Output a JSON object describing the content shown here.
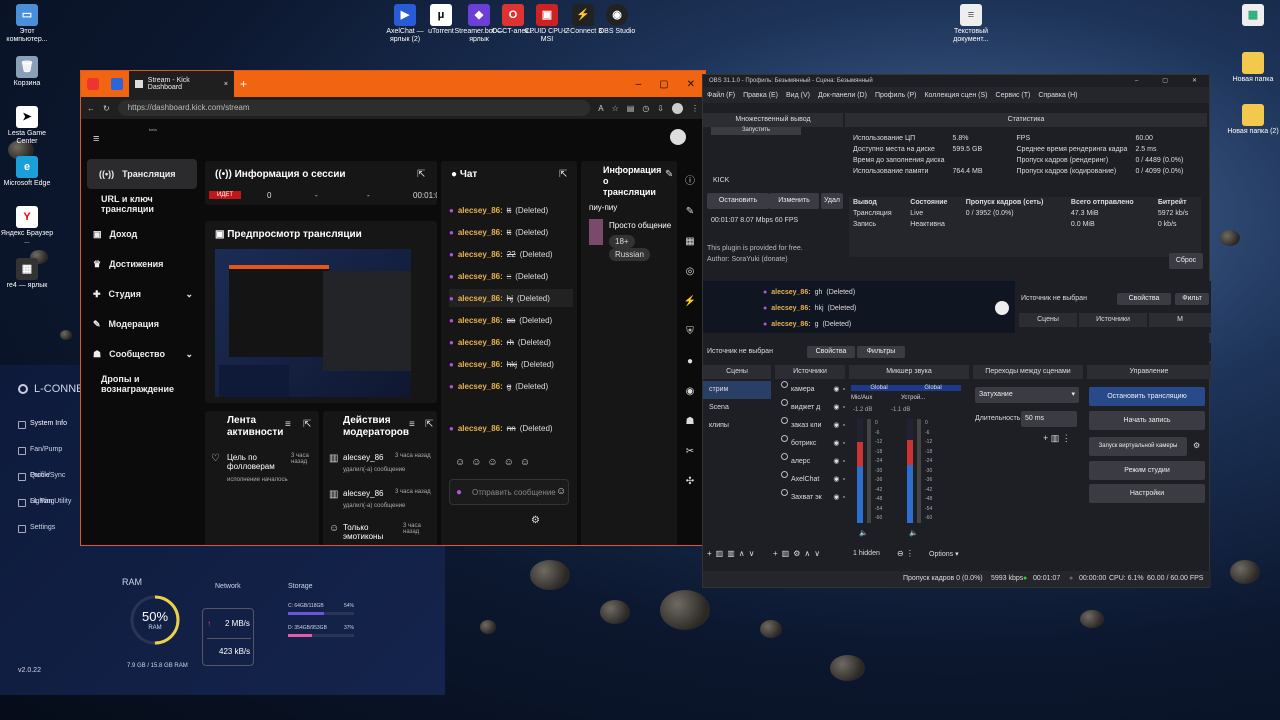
{
  "desktop": {
    "icons_left": [
      {
        "label": "Этот компьютер...",
        "icon": "computer-icon"
      },
      {
        "label": "Корзина",
        "icon": "trash-icon"
      },
      {
        "label": "Lesta Game Center",
        "icon": "lesta-icon"
      },
      {
        "label": "Microsoft Edge",
        "icon": "edge-icon"
      },
      {
        "label": "Яндекс Браузер ...",
        "icon": "yandex-icon"
      },
      {
        "label": "re4 — ярлык",
        "icon": "game-icon"
      }
    ],
    "icons_top": [
      {
        "label": "AxelChat — ярлык (2)",
        "icon": "axelchat-icon"
      },
      {
        "label": "uTorrent",
        "icon": "utorrent-icon"
      },
      {
        "label": "Streamer.bot — ярлык",
        "icon": "streamerbot-icon"
      },
      {
        "label": "OCCT-алек...",
        "icon": "occt-icon"
      },
      {
        "label": "CPUID CPU-Z MSI",
        "icon": "cpuz-icon"
      },
      {
        "label": "L-Connect 3",
        "icon": "lconnect-icon"
      },
      {
        "label": "OBS Studio",
        "icon": "obs-icon"
      }
    ],
    "icon_text_doc": "Текстовый документ...",
    "icons_right": [
      "Новая папка",
      "Новая папка (2)"
    ]
  },
  "lconnect": {
    "title": "L-CONNECT 3",
    "menu": [
      "System Info",
      "Fan/Pump Profile",
      "Quick/Sync Lighting",
      "SL Fan Utility",
      "Settings"
    ],
    "version": "v2.0.22",
    "ram_label": "RAM",
    "ram_percent": "50%",
    "ram_sub": "RAM",
    "ram_usage": "7.9 GB / 15.8 GB RAM",
    "ram_fraction": 0.5,
    "network_label": "Network",
    "net_up": "2 MB/s",
    "net_down": "423 kB/s",
    "storage_label": "Storage",
    "drives": [
      {
        "name": "C: 64GB/118GB",
        "pct": "54%",
        "fraction": 0.54
      },
      {
        "name": "D: 354GB/953GB",
        "pct": "37%",
        "fraction": 0.37
      }
    ]
  },
  "browser": {
    "tab_title": "Stream - Kick Dashboard",
    "new_tab": "+",
    "url": "https://dashboard.kick.com/stream",
    "kick_logo": "beta",
    "sidebar": [
      "Трансляция",
      "URL и ключ трансляции",
      "Доход",
      "Достижения",
      "Студия",
      "Модерация",
      "Сообщество",
      "Дропы и вознаграждение"
    ],
    "session": {
      "title": "Информация о сессии",
      "live": "ИДЕТ",
      "val1": "0",
      "val2": "-",
      "val3": "-",
      "time": "00:01:0"
    },
    "preview_title": "Предпросмотр трансляции",
    "feed": {
      "title": "Лента активности",
      "item_title": "Цель по фолловерам",
      "item_sub": "исполнение началось",
      "item_time": "3 часа назад"
    },
    "mod": {
      "title": "Действия модераторов",
      "rows": [
        {
          "user": "alecsey_86",
          "action": "удалил(-а) сообщение",
          "time": "3 часа назад"
        },
        {
          "user": "alecsey_86",
          "action": "удалил(-а) сообщение",
          "time": "3 часа назад"
        },
        {
          "user": "Только эмотиконы",
          "action": "",
          "time": "3 часа назад"
        }
      ]
    },
    "chat": {
      "title": "Чат",
      "rows": [
        {
          "user": "alecsey_86:",
          "msg": "tt",
          "del": "(Deleted)"
        },
        {
          "user": "alecsey_86:",
          "msg": "tt",
          "del": "(Deleted)"
        },
        {
          "user": "alecsey_86:",
          "msg": "22",
          "del": "(Deleted)"
        },
        {
          "user": "alecsey_86:",
          "msg": "::",
          "del": "(Deleted)"
        },
        {
          "user": "alecsey_86:",
          "msg": "hj",
          "del": "(Deleted)"
        },
        {
          "user": "alecsey_86:",
          "msg": "вв",
          "del": "(Deleted)"
        },
        {
          "user": "alecsey_86:",
          "msg": "rh",
          "del": "(Deleted)"
        },
        {
          "user": "alecsey_86:",
          "msg": "hkj",
          "del": "(Deleted)"
        },
        {
          "user": "alecsey_86:",
          "msg": "g",
          "del": "(Deleted)"
        },
        {
          "user": "alecsey_86:",
          "msg": "nn",
          "del": "(Deleted)"
        }
      ],
      "placeholder": "Отправить сообщение"
    },
    "info": {
      "title": "Информация о трансляции",
      "stream_title": "пиу-пиу",
      "category": "Просто общение",
      "tags": [
        "18+",
        "Russian"
      ]
    }
  },
  "obs": {
    "title": "OBS 31.1.0 - Профиль: Безымянный - Сцена: Безымянный",
    "menu": [
      "Файл (F)",
      "Правка (E)",
      "Вид (V)",
      "Док-панели (D)",
      "Профиль (P)",
      "Коллекция сцен (S)",
      "Сервис (T)",
      "Справка (H)"
    ],
    "multi_output": {
      "title": "Множественный вывод",
      "top_btn": "Запустить",
      "label": "KICK",
      "btns": [
        "Остановить",
        "Изменить",
        "Удал"
      ],
      "status": "00:01:07  8.07 Mbps  60 FPS",
      "note1": "This plugin is provided for free.",
      "note2": "Author: SoraYuki (donate)"
    },
    "stats": {
      "title": "Статистика",
      "rows": [
        [
          "Использование ЦП",
          "5.8%",
          "FPS",
          "60.00"
        ],
        [
          "Доступно места на диске",
          "599.5 GB",
          "Среднее время рендеринга кадра",
          "2.5 ms"
        ],
        [
          "Время до заполнения диска",
          "",
          "Пропуск кадров (рендеринг)",
          "0 / 4489 (0.0%)"
        ],
        [
          "Использование памяти",
          "764.4 MB",
          "Пропуск кадров (кодирование)",
          "0 / 4099 (0.0%)"
        ]
      ],
      "headers": [
        "Вывод",
        "Состояние",
        "Пропуск кадров (сеть)",
        "Всего отправлено",
        "Битрейт"
      ],
      "out_rows": [
        [
          "Трансляция",
          "Live",
          "0 / 3952 (0.0%)",
          "47.3 MiB",
          "5972 kb/s"
        ],
        [
          "Запись",
          "Неактивна",
          "",
          "0.0 MiB",
          "0 kb/s"
        ]
      ],
      "reset": "Сброс"
    },
    "preview_chat": [
      {
        "user": "alecsey_86:",
        "msg": "gh",
        "del": "(Deleted)"
      },
      {
        "user": "alecsey_86:",
        "msg": "hkj",
        "del": "(Deleted)"
      },
      {
        "user": "alecsey_86:",
        "msg": "g",
        "del": "(Deleted)"
      }
    ],
    "src_none_top": "Источник не выбран",
    "props_top": "Свойства",
    "filters_top": "Фильт",
    "tabs_top": [
      "Сцены",
      "Источники",
      "М"
    ],
    "src_none": "Источник не выбран",
    "props": "Свойства",
    "filters": "Фильтры",
    "docks": {
      "scenes": "Сцены",
      "sources": "Источники",
      "mixer": "Микшер звука",
      "transitions": "Переходы между сценами",
      "controls": "Управление"
    },
    "scenes": [
      "стрим",
      "Scena",
      "клипы"
    ],
    "sources": [
      "камера",
      "виджет д",
      "заказ кли",
      "ботрикс",
      "алерс",
      "AxelChat",
      "Захват эк"
    ],
    "mixer": [
      {
        "name": "Global",
        "label": "Mic/Aux",
        "db": "-1.2 dB",
        "level": 0.78
      },
      {
        "name": "Global",
        "label": "Устрой...",
        "db": "-1.1 dB",
        "level": 0.8
      }
    ],
    "mixer_ticks": [
      "0",
      "-6",
      "-12",
      "-18",
      "-24",
      "-30",
      "-36",
      "-42",
      "-48",
      "-54",
      "-60"
    ],
    "transition": "Затухание",
    "duration_label": "Длительность",
    "duration": "50 ms",
    "controls": [
      "Остановить трансляцию",
      "Начать запись",
      "Запуск виртуальной камеры",
      "Режим студии",
      "Настройки"
    ],
    "mixer_footer": "1 hidden",
    "options": "Options",
    "status": {
      "dropped": "Пропуск кадров 0 (0.0%)",
      "bitrate": "5993 kbps",
      "live_time": "00:01:07",
      "rec_time": "00:00:00",
      "cpu": "CPU: 6.1%",
      "fps": "60.00 / 60.00 FPS"
    }
  }
}
